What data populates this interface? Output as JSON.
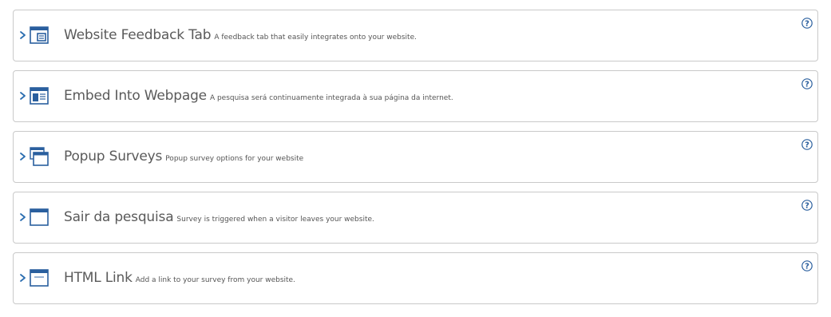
{
  "panels": [
    {
      "title": "Website Feedback Tab",
      "description": "A feedback tab that easily integrates onto your website.",
      "icon": "feedback-tab-icon"
    },
    {
      "title": "Embed Into Webpage",
      "description": "A pesquisa será continuamente integrada à sua página da internet.",
      "icon": "embed-webpage-icon"
    },
    {
      "title": "Popup Surveys",
      "description": "Popup survey options for your website",
      "icon": "popup-windows-icon"
    },
    {
      "title": "Sair da pesquisa",
      "description": "Survey is triggered when a visitor leaves your website.",
      "icon": "exit-survey-window-icon"
    },
    {
      "title": "HTML Link",
      "description": "Add a link to your survey from your website.",
      "icon": "html-link-window-icon"
    }
  ],
  "help_glyph": "?",
  "colors": {
    "icon_blue": "#2a5f9e",
    "chevron_blue": "#2a6db0",
    "border": "#c9c9c9",
    "title": "#5a5a5a"
  }
}
